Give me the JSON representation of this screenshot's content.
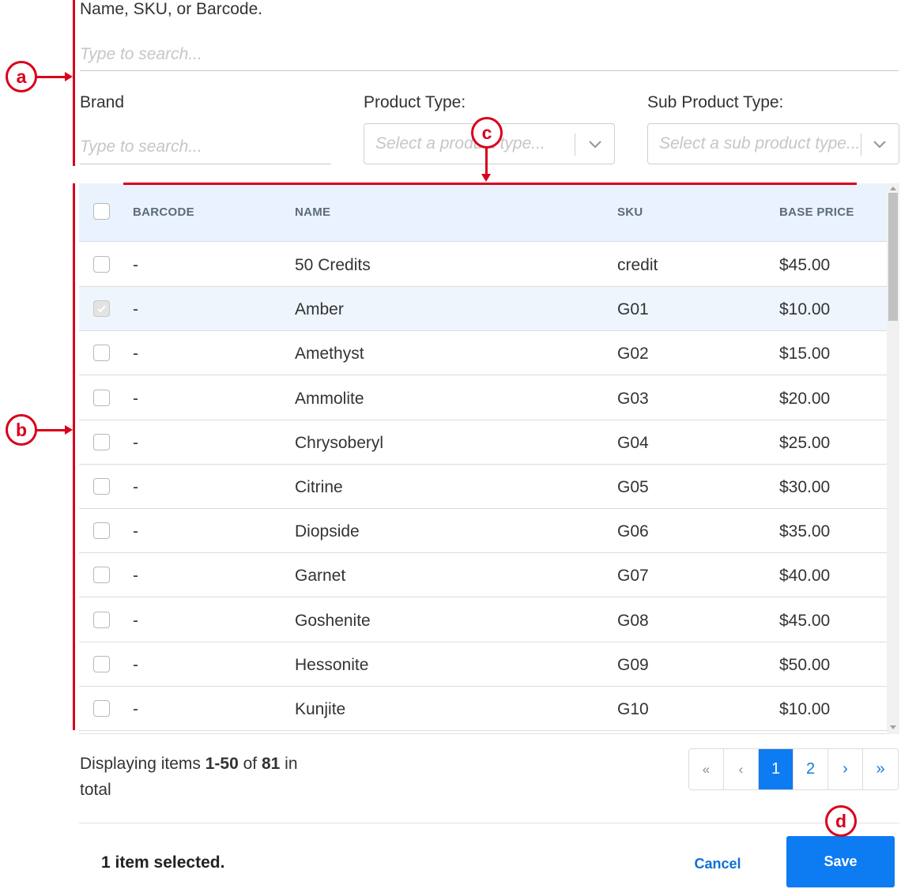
{
  "search": {
    "label": "Name, SKU, or Barcode.",
    "placeholder": "Type to search..."
  },
  "filters": {
    "brand_label": "Brand",
    "brand_placeholder": "Type to search...",
    "product_type_label": "Product Type:",
    "product_type_placeholder": "Select a product type...",
    "sub_product_type_label": "Sub Product Type:",
    "sub_product_type_placeholder": "Select a sub product type..."
  },
  "table": {
    "headers": [
      "BARCODE",
      "NAME",
      "SKU",
      "BASE PRICE"
    ],
    "rows": [
      {
        "barcode": "-",
        "name": "50 Credits",
        "sku": "credit",
        "price": "$45.00",
        "checked": false
      },
      {
        "barcode": "-",
        "name": "Amber",
        "sku": "G01",
        "price": "$10.00",
        "checked": true
      },
      {
        "barcode": "-",
        "name": "Amethyst",
        "sku": "G02",
        "price": "$15.00",
        "checked": false
      },
      {
        "barcode": "-",
        "name": "Ammolite",
        "sku": "G03",
        "price": "$20.00",
        "checked": false
      },
      {
        "barcode": "-",
        "name": "Chrysoberyl",
        "sku": "G04",
        "price": "$25.00",
        "checked": false
      },
      {
        "barcode": "-",
        "name": "Citrine",
        "sku": "G05",
        "price": "$30.00",
        "checked": false
      },
      {
        "barcode": "-",
        "name": "Diopside",
        "sku": "G06",
        "price": "$35.00",
        "checked": false
      },
      {
        "barcode": "-",
        "name": "Garnet",
        "sku": "G07",
        "price": "$40.00",
        "checked": false
      },
      {
        "barcode": "-",
        "name": "Goshenite",
        "sku": "G08",
        "price": "$45.00",
        "checked": false
      },
      {
        "barcode": "-",
        "name": "Hessonite",
        "sku": "G09",
        "price": "$50.00",
        "checked": false
      },
      {
        "barcode": "-",
        "name": "Kunjite",
        "sku": "G10",
        "price": "$10.00",
        "checked": false
      }
    ]
  },
  "footer": {
    "info_prefix": "Displaying items ",
    "info_range": "1-50",
    "info_of": " of ",
    "info_total": "81",
    "info_suffix": " in total"
  },
  "pagination": {
    "first": "«",
    "prev": "‹",
    "pages": [
      "1",
      "2"
    ],
    "current": "1",
    "next": "›",
    "last": "»"
  },
  "actions": {
    "selected_text": "1 item selected.",
    "cancel_label": "Cancel",
    "save_label": "Save"
  },
  "annotations": {
    "a": "a",
    "b": "b",
    "c": "c",
    "d": "d"
  },
  "colors": {
    "accent": "#0d7bf2",
    "header_bg": "#eaf3fd",
    "annotation": "#d9001b"
  }
}
